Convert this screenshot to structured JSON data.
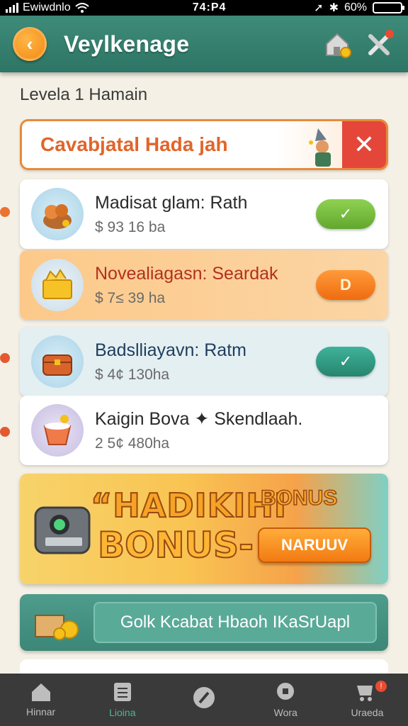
{
  "status_bar": {
    "carrier": "Ewiwdnlo",
    "time": "74:P4",
    "battery": "60%"
  },
  "header": {
    "title": "Veylkenage",
    "back_glyph": "‹"
  },
  "subheading": "Levela 1 Hamain",
  "banner": {
    "text": "Cavabjatal Hada jah",
    "close_glyph": "✕"
  },
  "items": [
    {
      "title": "Madisat glam: Rath",
      "subtitle": "$ 93 16 ba",
      "action": "✓",
      "icon": "basket-icon",
      "bg": "#ffffff",
      "pill_color": "#7cc142"
    },
    {
      "title": "Novealiagasn: Seardak",
      "subtitle": "$ 7≤ 39 ha",
      "action": "D",
      "icon": "treasure-box-icon",
      "bg": "#fbc88a",
      "pill_color": "#f47c24"
    },
    {
      "title": "Badslliayavn: Ratm",
      "subtitle": "$ 4¢ 130ha",
      "action": "✓",
      "icon": "chest-icon",
      "bg": "#e4eff2",
      "pill_color": "#2f9b85"
    },
    {
      "title": "Kaigin Bova ✦ Skendlaah.",
      "subtitle": "2 5¢ 480ha",
      "action": "",
      "icon": "cup-icon",
      "bg": "#ffffff",
      "pill_color": ""
    }
  ],
  "promo": {
    "line1": "“HADIKIHI",
    "line2": "BONUS-",
    "small": "BONUS",
    "button": "NARUUV"
  },
  "cta": {
    "label": "Golk Kcabat Hbaoh IKaSrUapl"
  },
  "tabs": [
    {
      "label": "Hinnar",
      "icon": "home-icon"
    },
    {
      "label": "Lioina",
      "icon": "list-icon"
    },
    {
      "label": "",
      "icon": "slash-circle-icon"
    },
    {
      "label": "Wora",
      "icon": "chat-icon"
    },
    {
      "label": "Uraeda",
      "icon": "cart-icon",
      "badge": "!"
    }
  ]
}
